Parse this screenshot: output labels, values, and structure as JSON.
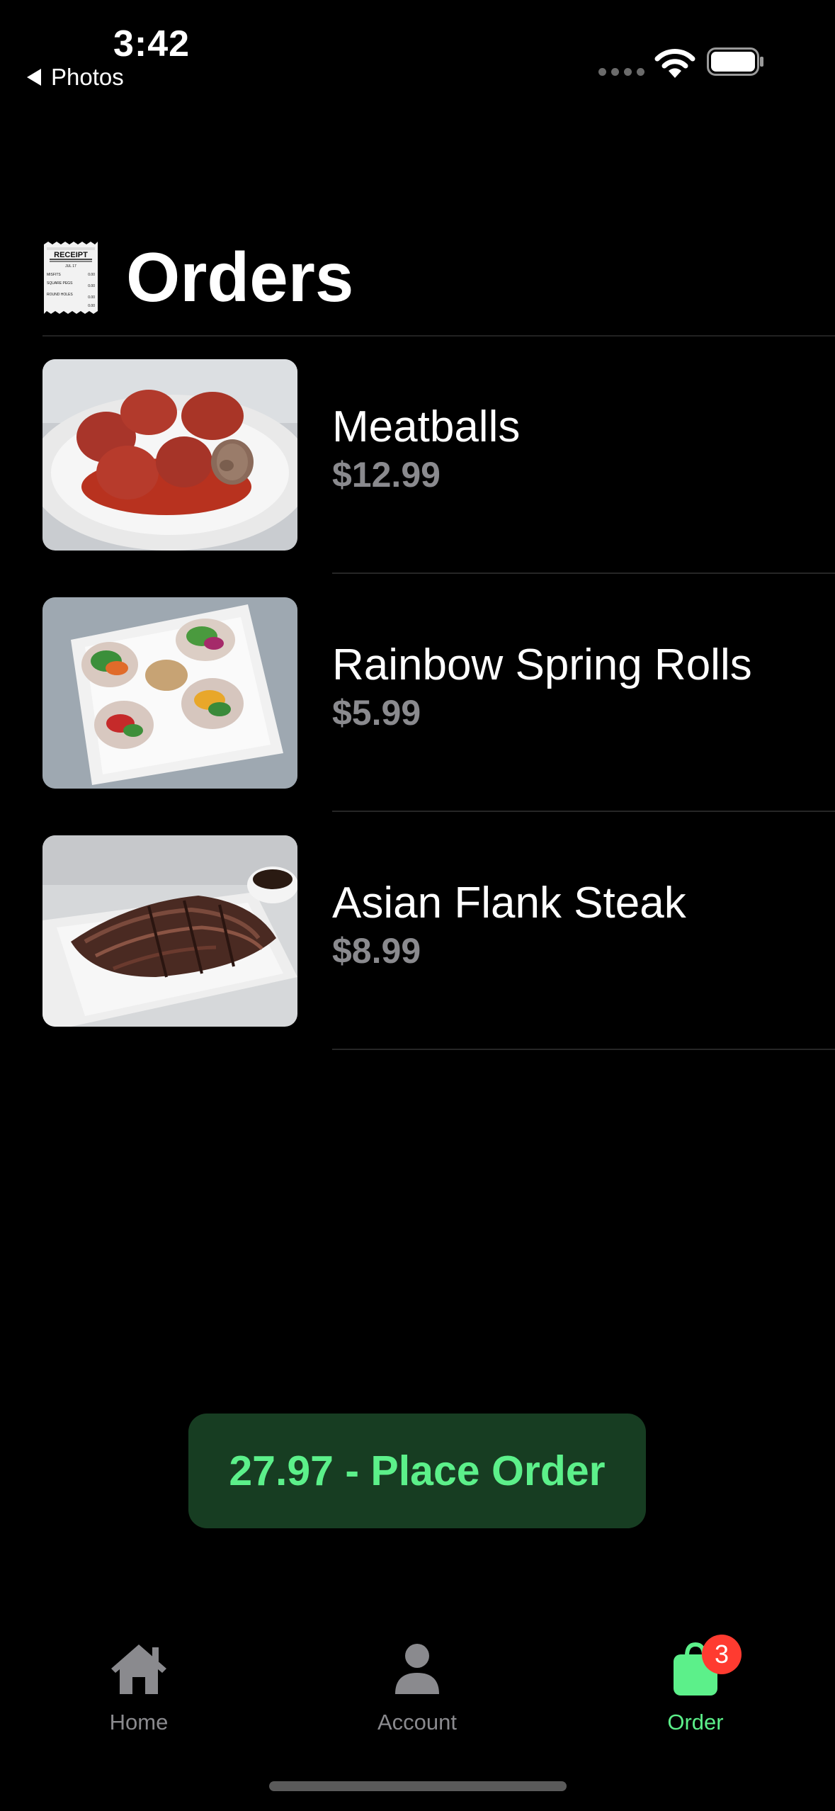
{
  "status_bar": {
    "time": "3:42",
    "back_label": "Photos"
  },
  "header": {
    "title": "Orders",
    "receipt_icon": {
      "heading": "RECEIPT",
      "date": "JUL 17",
      "rows": [
        "MISFITS",
        "SQUARE PEGS",
        "ROUND HOLES"
      ],
      "amount": "0.00"
    }
  },
  "orders": [
    {
      "name": "Meatballs",
      "price": "$12.99",
      "image": "meatballs-photo"
    },
    {
      "name": "Rainbow Spring Rolls",
      "price": "$5.99",
      "image": "spring-rolls-photo"
    },
    {
      "name": "Asian Flank Steak",
      "price": "$8.99",
      "image": "flank-steak-photo"
    }
  ],
  "place_order": {
    "label": "27.97 - Place Order"
  },
  "tabs": [
    {
      "label": "Home",
      "icon": "house-icon"
    },
    {
      "label": "Account",
      "icon": "person-icon"
    },
    {
      "label": "Order",
      "icon": "bag-icon",
      "badge": "3",
      "active": true
    }
  ],
  "colors": {
    "accent": "#5cf08a",
    "button_bg": "#173d22",
    "badge": "#ff3b30",
    "secondary_text": "#8a8a8e"
  }
}
